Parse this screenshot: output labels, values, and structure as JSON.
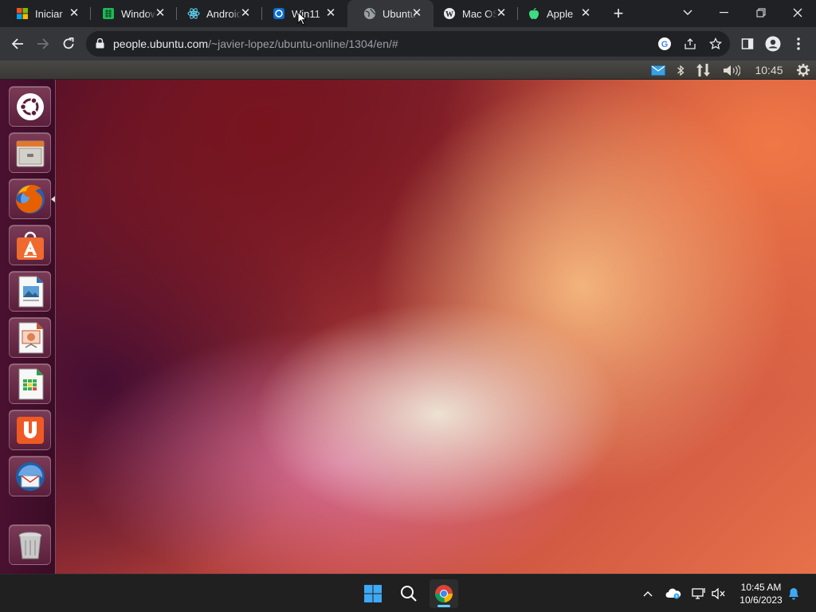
{
  "browser": {
    "tabs": [
      {
        "title": "Iniciar",
        "icon": "windows-logo-icon",
        "active": false
      },
      {
        "title": "Windows",
        "icon": "green-grid-icon",
        "active": false
      },
      {
        "title": "Android",
        "icon": "react-atom-icon",
        "active": false
      },
      {
        "title": "Win11",
        "icon": "win11-blue-icon",
        "active": false
      },
      {
        "title": "Ubuntu",
        "icon": "globe-icon",
        "active": true
      },
      {
        "title": "Mac OS",
        "icon": "wordpress-icon",
        "active": false
      },
      {
        "title": "Apple",
        "icon": "apple-green-icon",
        "active": false
      }
    ],
    "close_glyph": "✕",
    "new_tab_glyph": "+",
    "url_host": "people.ubuntu.com",
    "url_path": "/~javier-lopez/ubuntu-online/1304/en/#"
  },
  "ubuntu": {
    "panel_time": "10:45",
    "launcher_items": [
      "ubuntu-dash-icon",
      "files-icon",
      "firefox-icon",
      "software-center-icon",
      "libreoffice-writer-icon",
      "libreoffice-impress-icon",
      "libreoffice-calc-icon",
      "ubuntu-one-icon",
      "thunderbird-icon",
      "trash-icon"
    ],
    "colors": {
      "launcher": "#4a1030",
      "wallpaper_orange": "#e7714a",
      "wallpaper_purple": "#4b0f2e"
    }
  },
  "taskbar": {
    "clock_time": "10:45 AM",
    "clock_date": "10/6/2023",
    "accent": "#60cdff"
  }
}
